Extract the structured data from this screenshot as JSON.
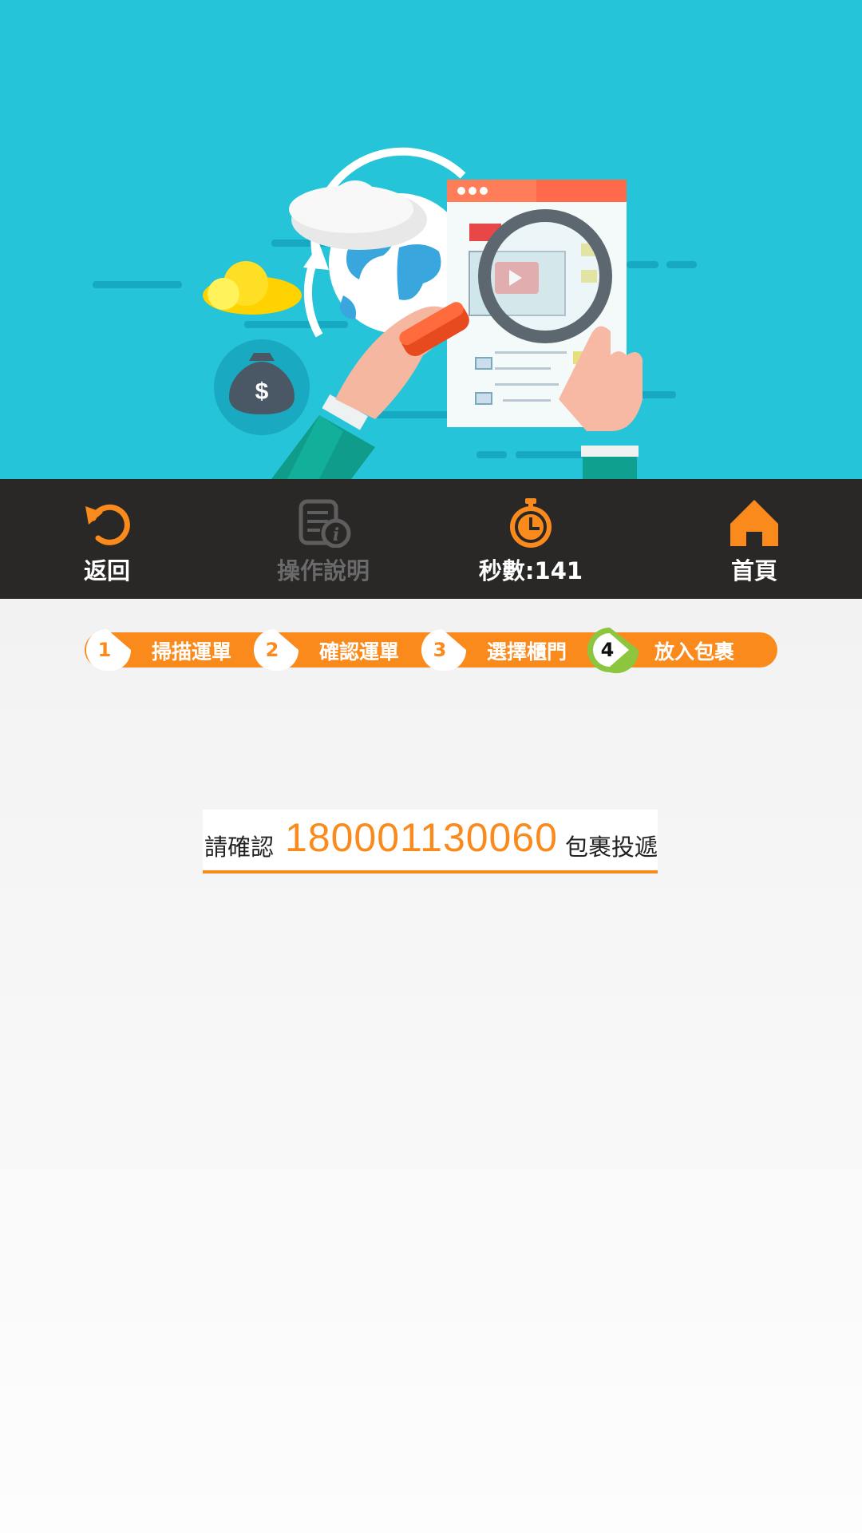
{
  "toolbar": {
    "back_label": "返回",
    "help_label": "操作說明",
    "timer_label": "秒數:141",
    "home_label": "首頁"
  },
  "steps": [
    {
      "num": "1",
      "label": "掃描運單"
    },
    {
      "num": "2",
      "label": "確認運單"
    },
    {
      "num": "3",
      "label": "選擇櫃門"
    },
    {
      "num": "4",
      "label": "放入包裹",
      "active": true
    }
  ],
  "confirm": {
    "prefix": "請確認",
    "tracking_number": "180001130060",
    "suffix": "包裹投遞"
  },
  "banner": {
    "money_symbol": "$"
  },
  "colors": {
    "accent": "#fb8a1d",
    "banner_bg": "#25c4d8",
    "toolbar_bg": "#2a2826",
    "active_step_ring": "#8cc63f"
  }
}
